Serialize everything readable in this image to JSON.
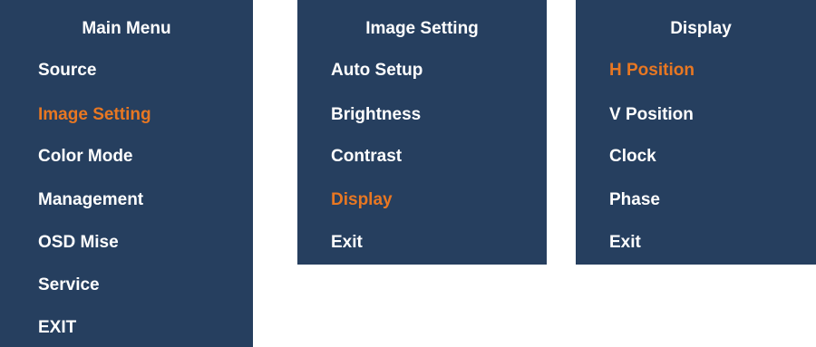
{
  "colors": {
    "panel_bg": "#263f5f",
    "text": "#ffffff",
    "selected": "#e87722"
  },
  "main_menu": {
    "title": "Main Menu",
    "items": [
      {
        "label": "Source",
        "selected": false
      },
      {
        "label": "Image Setting",
        "selected": true
      },
      {
        "label": "Color Mode",
        "selected": false
      },
      {
        "label": "Management",
        "selected": false
      },
      {
        "label": "OSD Mise",
        "selected": false
      },
      {
        "label": "Service",
        "selected": false
      },
      {
        "label": "EXIT",
        "selected": false
      }
    ]
  },
  "image_setting": {
    "title": "Image Setting",
    "items": [
      {
        "label": "Auto Setup",
        "selected": false
      },
      {
        "label": "Brightness",
        "selected": false
      },
      {
        "label": "Contrast",
        "selected": false
      },
      {
        "label": "Display",
        "selected": true
      },
      {
        "label": "Exit",
        "selected": false
      }
    ]
  },
  "display": {
    "title": "Display",
    "items": [
      {
        "label": "H Position",
        "selected": true
      },
      {
        "label": "V Position",
        "selected": false
      },
      {
        "label": "Clock",
        "selected": false
      },
      {
        "label": "Phase",
        "selected": false
      },
      {
        "label": "Exit",
        "selected": false
      }
    ]
  }
}
